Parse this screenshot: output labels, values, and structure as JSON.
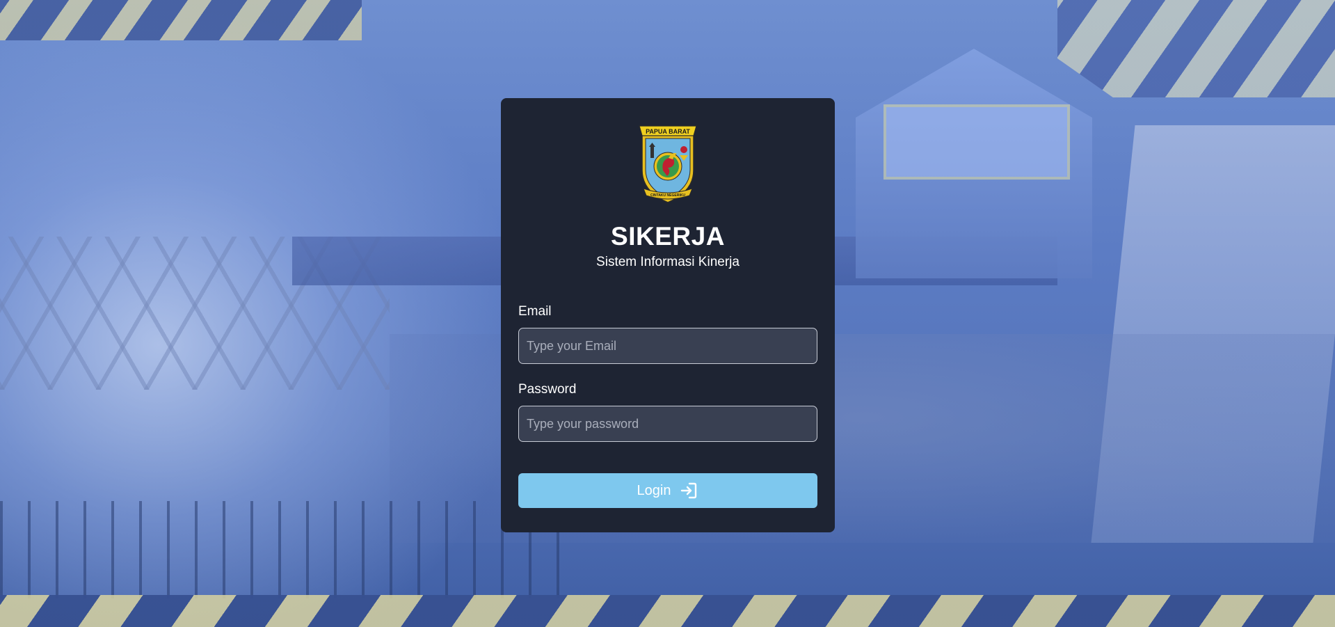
{
  "logo": {
    "banner_text": "PAPUA BARAT",
    "motto_text": "CINTAKU NEGERIKU",
    "colors": {
      "shield": "#6fb6e0",
      "border": "#e8c020",
      "banner": "#f0d020"
    }
  },
  "app": {
    "title": "SIKERJA",
    "subtitle": "Sistem Informasi Kinerja"
  },
  "form": {
    "email_label": "Email",
    "email_placeholder": "Type your Email",
    "email_value": "",
    "password_label": "Password",
    "password_placeholder": "Type your password",
    "password_value": "",
    "login_label": "Login",
    "login_icon": "login-arrow-icon"
  },
  "colors": {
    "card_bg": "#1e2433",
    "input_bg": "#394052",
    "button_bg": "#7ec8ee",
    "background_tint": "#5c7cc4"
  }
}
